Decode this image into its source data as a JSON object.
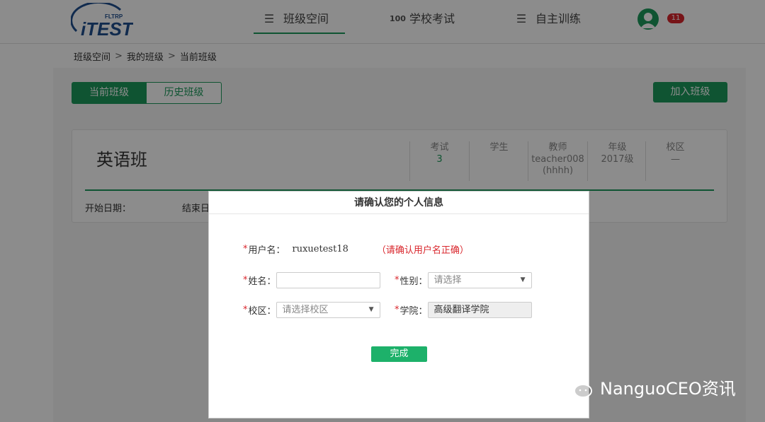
{
  "header": {
    "logo_text": "iTEST",
    "logo_subtext": "FLTRP",
    "nav": [
      {
        "label": "班级空间",
        "icon": "menu-icon",
        "active": true
      },
      {
        "label": "学校考试",
        "icon": "grade-100-icon",
        "active": false
      },
      {
        "label": "自主训练",
        "icon": "menu-icon",
        "active": false
      }
    ],
    "notification_count": "11"
  },
  "breadcrumb": [
    "班级空间",
    "我的班级",
    "当前班级"
  ],
  "tabs": {
    "current": "当前班级",
    "history": "历史班级"
  },
  "join_button": "加入班级",
  "class_card": {
    "name": "英语班",
    "stats": [
      {
        "label": "考试",
        "value": "3"
      },
      {
        "label": "学生",
        "value": ""
      },
      {
        "label": "教师",
        "value": "teacher008(hhhh)"
      },
      {
        "label": "年级",
        "value": "2017级"
      },
      {
        "label": "校区",
        "value": "—"
      }
    ],
    "start_date_label": "开始日期：",
    "end_date_label": "结束日"
  },
  "modal": {
    "title": "请确认您的个人信息",
    "username_label": "用户名：",
    "username_value": "ruxuetest18",
    "username_note": "（请确认用户名正确）",
    "name_label": "姓名：",
    "name_value": "",
    "gender_label": "性别：",
    "gender_placeholder": "请选择",
    "campus_label": "校区：",
    "campus_placeholder": "请选择校区",
    "college_label": "学院：",
    "college_value": "高级翻译学院",
    "required_mark": "*",
    "done_button": "完成"
  },
  "watermark": {
    "text": "NanguoCEO资讯",
    "icon": "wechat-icon"
  },
  "colors": {
    "accent": "#1d9a5c",
    "danger": "#d9262c"
  }
}
